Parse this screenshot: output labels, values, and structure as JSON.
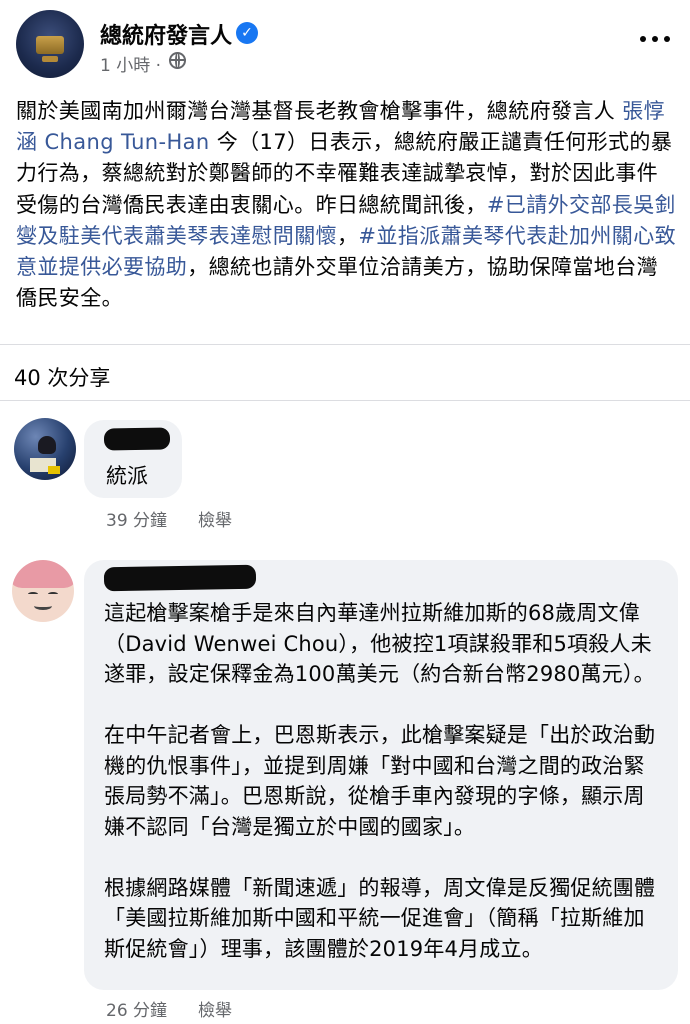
{
  "post": {
    "page_name": "總統府發言人",
    "time": "1 小時 ·",
    "body": [
      {
        "text": "關於美國南加州爾灣台灣基督長老教會槍擊事件，總統府發言人 ",
        "tag": false
      },
      {
        "text": "張惇涵 Chang Tun-Han",
        "tag": true
      },
      {
        "text": " 今（17）日表示，總統府嚴正譴責任何形式的暴力行為，蔡總統對於鄭醫師的不幸罹難表達誠摯哀悼，對於因此事件受傷的台灣僑民表達由衷關心。昨日總統聞訊後，",
        "tag": false
      },
      {
        "text": "#已請外交部長吳釗燮及駐美代表蕭美琴表達慰問關懷",
        "tag": true
      },
      {
        "text": "，",
        "tag": false
      },
      {
        "text": "#並指派蕭美琴代表赴加州關心致意並提供必要協助",
        "tag": true
      },
      {
        "text": "，總統也請外交單位洽請美方，協助保障當地台灣僑民安全。",
        "tag": false
      }
    ]
  },
  "shares": "40 次分享",
  "comments": [
    {
      "text": "統派",
      "time": "39 分鐘",
      "report": "檢舉"
    },
    {
      "paragraphs": [
        "這起槍擊案槍手是來自內華達州拉斯維加斯的68歲周文偉（David Wenwei Chou），他被控1項謀殺罪和5項殺人未遂罪，設定保釋金為100萬美元（約合新台幣2980萬元）。",
        "在中午記者會上，巴恩斯表示，此槍擊案疑是「出於政治動機的仇恨事件」，並提到周嫌「對中國和台灣之間的政治緊張局勢不滿」。巴恩斯說，從槍手車內發現的字條，顯示周嫌不認同「台灣是獨立於中國的國家」。",
        "根據網路媒體「新聞速遞」的報導，周文偉是反獨促統團體「美國拉斯維加斯中國和平統一促進會」（簡稱「拉斯維加斯促統會」）理事，該團體於2019年4月成立。"
      ],
      "time": "26 分鐘",
      "report": "檢舉"
    }
  ],
  "colors": {
    "link": "#385898",
    "verified": "#1877f2",
    "bubble": "#f0f2f5",
    "meta": "#65676b"
  },
  "icons": {
    "verified": "verified-badge-icon",
    "privacy": "globe-icon",
    "menu": "more-options-icon"
  }
}
